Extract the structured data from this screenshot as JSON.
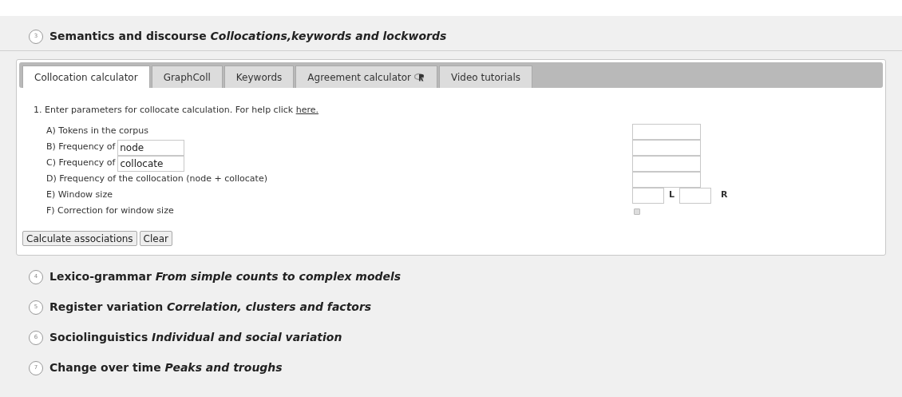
{
  "sections": [
    {
      "number": "3",
      "heading": "Semantics and discourse *Collocations,keywords and lockwords*",
      "expanded": true,
      "tabs": [
        {
          "label": "Collocation calculator",
          "selected": true
        },
        {
          "label": "GraphColl",
          "selected": false
        },
        {
          "label": "Keywords",
          "selected": false
        },
        {
          "label": "Agreement calculator",
          "selected": false,
          "badge": true
        },
        {
          "label": "Video tutorials",
          "selected": false
        }
      ],
      "instruction": "1. Enter parameters for collocate calculation. For help click",
      "help_link": "here.",
      "rows": [
        {
          "kind": "field",
          "label": "A) Tokens in the corpus"
        },
        {
          "kind": "field",
          "label": "B) Frequency of",
          "inline_value": "node"
        },
        {
          "kind": "field",
          "label": "C) Frequency of",
          "inline_value": "collocate"
        },
        {
          "kind": "field",
          "label": "D) Frequency of the collocation (node + collocate)"
        },
        {
          "kind": "window",
          "label": "E) Window size",
          "left_label": "L",
          "right_label": "R"
        },
        {
          "kind": "checkbox",
          "label": "F) Correction for window size",
          "checked": false
        }
      ],
      "buttons": [
        "Calculate associations",
        "Clear"
      ]
    },
    {
      "number": "4",
      "heading": "Lexico-grammar *From simple counts to complex models*",
      "expanded": false
    },
    {
      "number": "5",
      "heading": "Register variation *Correlation, clusters and factors*",
      "expanded": false
    },
    {
      "number": "6",
      "heading": "Sociolinguistics *Individual and social variation*",
      "expanded": false
    },
    {
      "number": "7",
      "heading": "Change over time *Peaks and troughs*",
      "expanded": false
    }
  ]
}
